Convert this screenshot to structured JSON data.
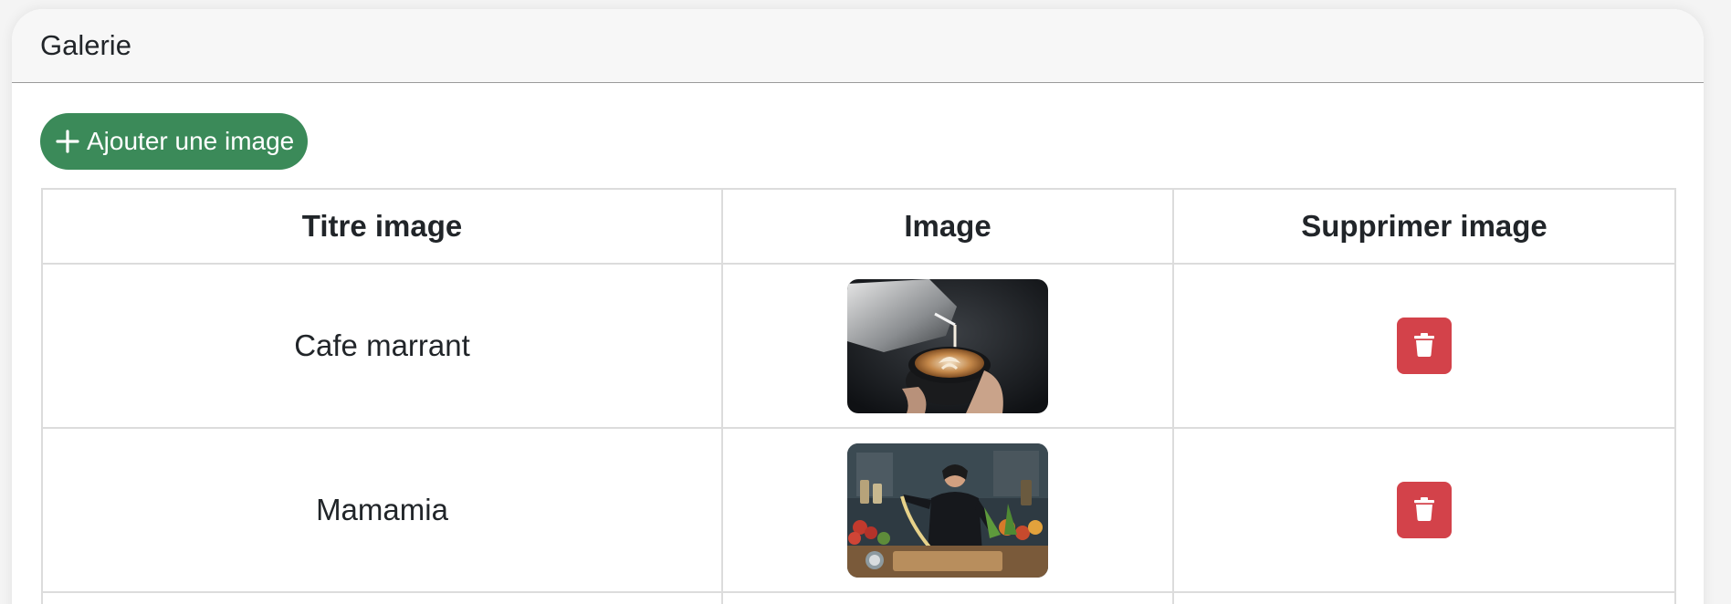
{
  "card": {
    "title": "Galerie"
  },
  "toolbar": {
    "add_label": "Ajouter une image",
    "add_icon": "plus-icon"
  },
  "table": {
    "headers": [
      "Titre image",
      "Image",
      "Supprimer image"
    ],
    "rows": [
      {
        "title": "Cafe marrant",
        "image": "latte-art-photo",
        "delete_icon": "trash-icon"
      },
      {
        "title": "Mamamia",
        "image": "chef-kitchen-photo",
        "delete_icon": "trash-icon"
      }
    ]
  },
  "colors": {
    "add_button": "#3b8a59",
    "delete_button": "#d3424a",
    "header_bg": "#f7f7f7",
    "border": "#dcdcdc"
  }
}
